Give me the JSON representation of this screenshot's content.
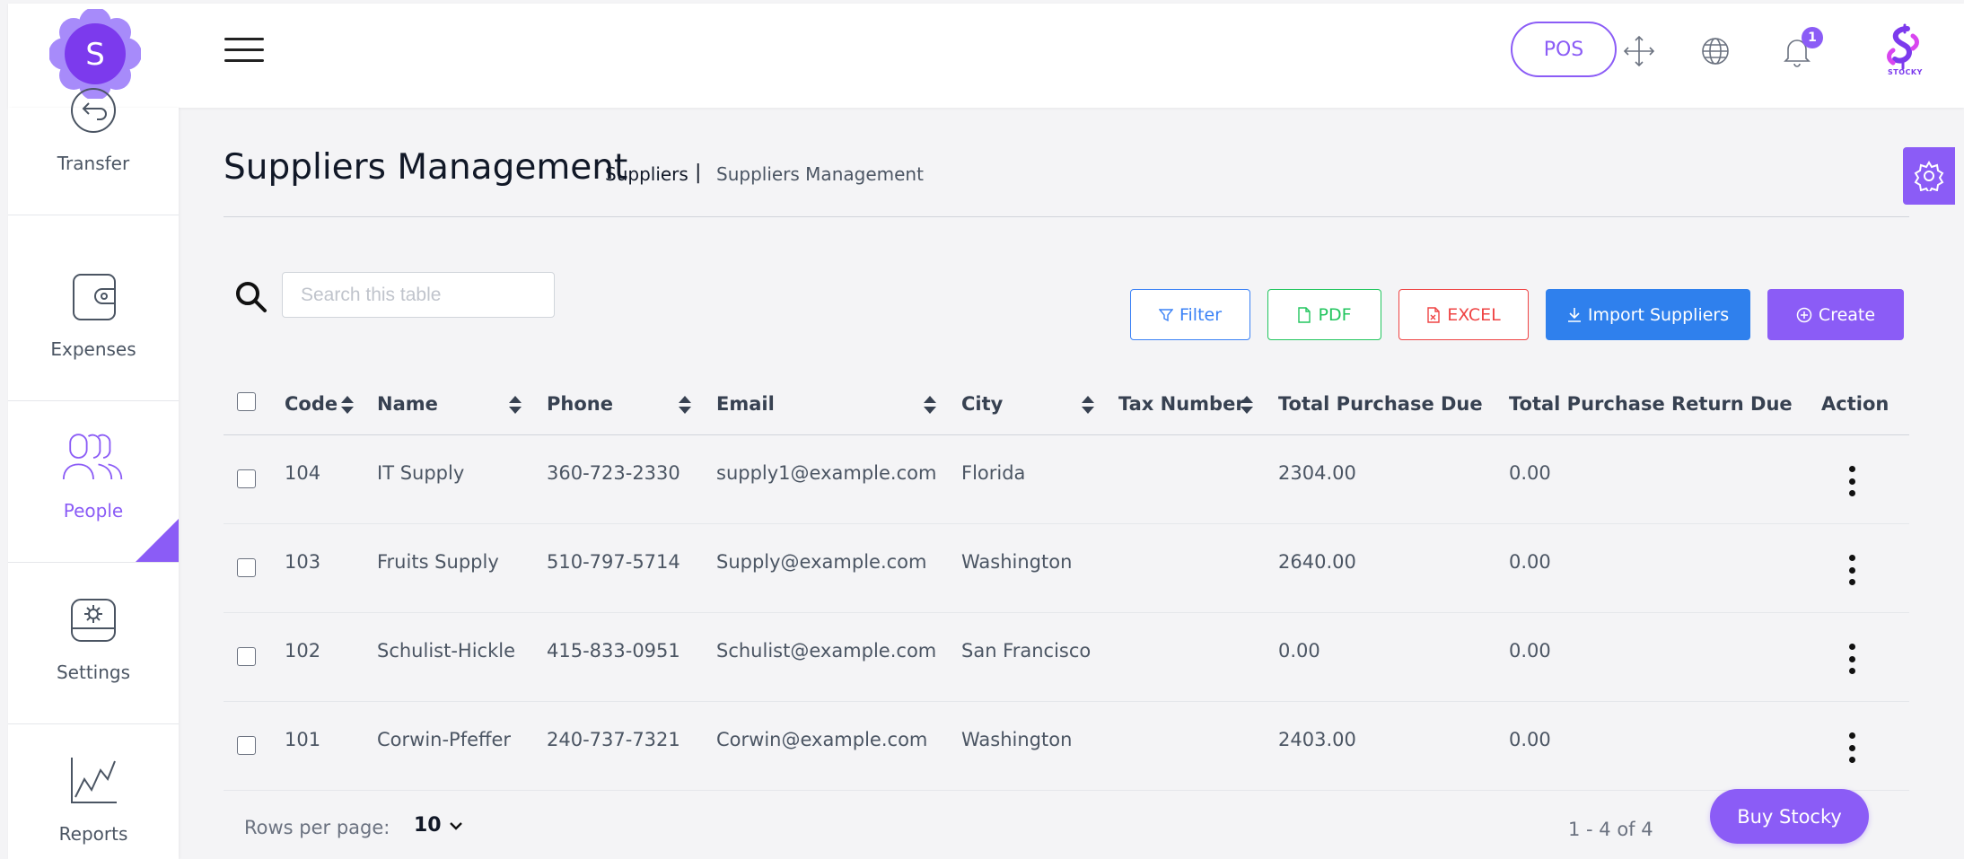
{
  "header": {
    "logo_letter": "S",
    "pos_label": "POS",
    "notification_count": "1",
    "brand_text": "STOCKY"
  },
  "sidebar": {
    "items": [
      {
        "label": "Transfer",
        "icon": "transfer-icon"
      },
      {
        "label": "Expenses",
        "icon": "wallet-icon"
      },
      {
        "label": "People",
        "icon": "people-icon",
        "active": true
      },
      {
        "label": "Settings",
        "icon": "settings-icon"
      },
      {
        "label": "Reports",
        "icon": "chart-icon"
      }
    ]
  },
  "page": {
    "title": "Suppliers Management",
    "breadcrumb_parent": "Suppliers",
    "breadcrumb_sep": "|",
    "breadcrumb_current": "Suppliers Management"
  },
  "toolbar": {
    "search_placeholder": "Search this table",
    "filter_label": "Filter",
    "pdf_label": "PDF",
    "excel_label": "EXCEL",
    "import_label": "Import Suppliers",
    "create_label": "Create"
  },
  "table": {
    "columns": [
      "Code",
      "Name",
      "Phone",
      "Email",
      "City",
      "Tax Number",
      "Total Purchase Due",
      "Total Purchase Return Due",
      "Action"
    ],
    "rows": [
      {
        "code": "104",
        "name": "IT Supply",
        "phone": "360-723-2330",
        "email": "supply1@example.com",
        "city": "Florida",
        "tax": "",
        "due": "2304.00",
        "return_due": "0.00"
      },
      {
        "code": "103",
        "name": "Fruits Supply",
        "phone": "510-797-5714",
        "email": "Supply@example.com",
        "city": "Washington",
        "tax": "",
        "due": "2640.00",
        "return_due": "0.00"
      },
      {
        "code": "102",
        "name": "Schulist-Hickle",
        "phone": "415-833-0951",
        "email": "Schulist@example.com",
        "city": "San Francisco",
        "tax": "",
        "due": "0.00",
        "return_due": "0.00"
      },
      {
        "code": "101",
        "name": "Corwin-Pfeffer",
        "phone": "240-737-7321",
        "email": "Corwin@example.com",
        "city": "Washington",
        "tax": "",
        "due": "2403.00",
        "return_due": "0.00"
      }
    ]
  },
  "footer": {
    "rows_per_page_label": "Rows per page:",
    "rows_per_page_value": "10",
    "pager_info": "1 - 4 of 4",
    "buy_label": "Buy Stocky"
  },
  "colors": {
    "accent": "#8b5cf6",
    "import": "#2f80ed",
    "filter": "#3b82f6",
    "pdf": "#22c55e",
    "excel": "#ef4444"
  }
}
